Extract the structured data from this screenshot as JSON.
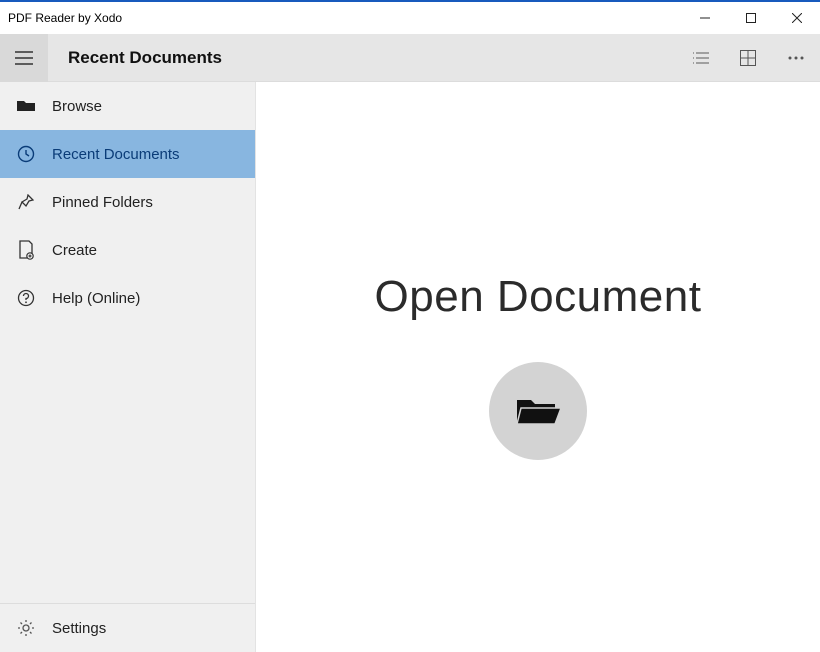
{
  "window": {
    "title": "PDF Reader by Xodo"
  },
  "toolbar": {
    "title": "Recent Documents"
  },
  "sidebar": {
    "items": [
      {
        "label": "Browse"
      },
      {
        "label": "Recent Documents"
      },
      {
        "label": "Pinned Folders"
      },
      {
        "label": "Create"
      },
      {
        "label": "Help (Online)"
      }
    ],
    "footer": {
      "settings_label": "Settings"
    }
  },
  "main": {
    "heading": "Open Document"
  }
}
